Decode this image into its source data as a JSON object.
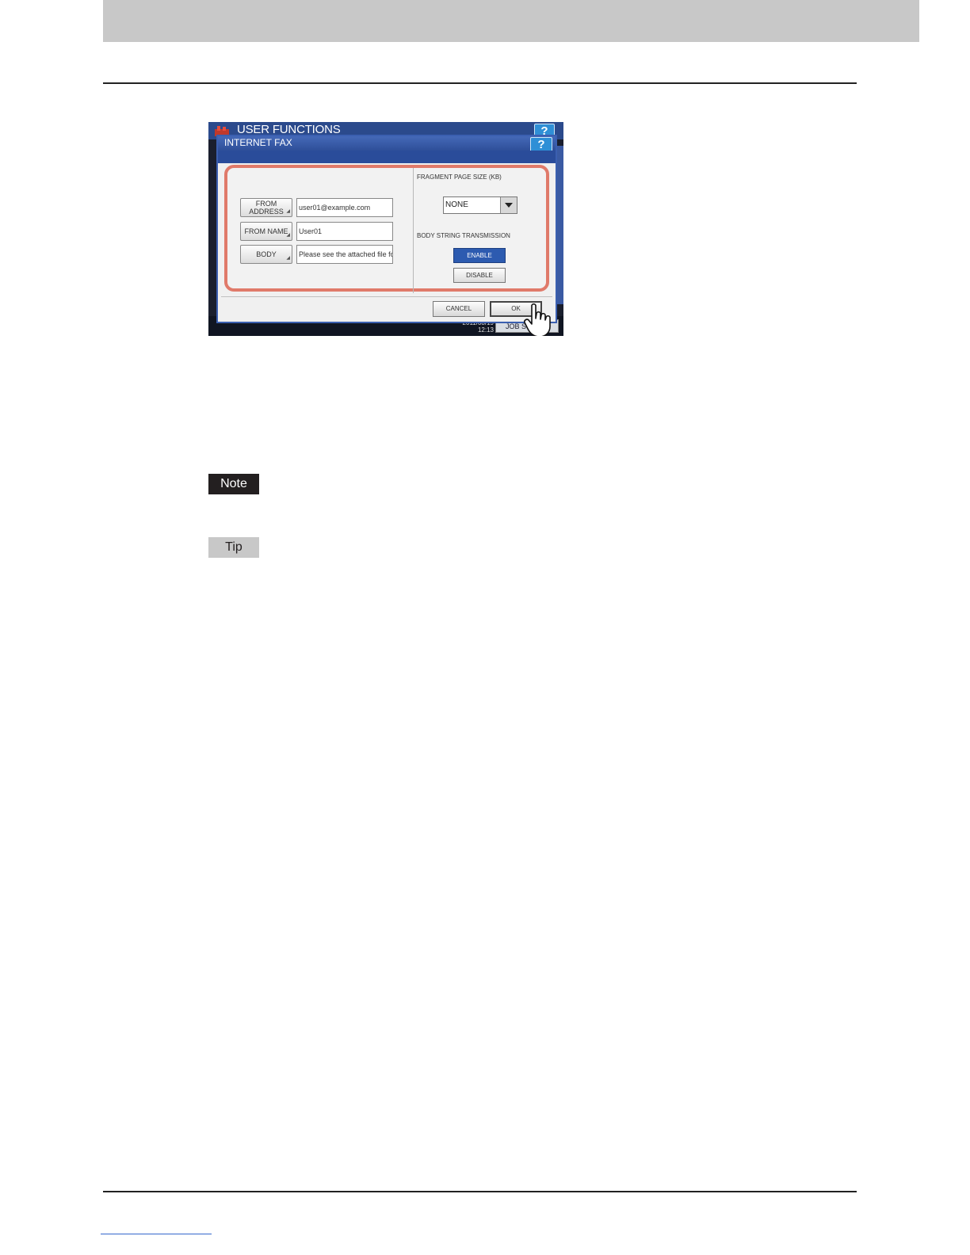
{
  "background_window": {
    "title": "USER FUNCTIONS",
    "help_label": "?",
    "clock": [
      "2011/08/19",
      "12:13"
    ],
    "job_button_label": "JOB S"
  },
  "dialog": {
    "title": "INTERNET FAX",
    "help_label": "?",
    "fields": [
      {
        "button_label_line1": "FROM",
        "button_label_line2": "ADDRESS",
        "value": "user01@example.com"
      },
      {
        "button_label_line1": "FROM NAME",
        "button_label_line2": "",
        "value": "User01"
      },
      {
        "button_label_line1": "BODY",
        "button_label_line2": "",
        "value": "Please see the attached file fo"
      }
    ],
    "fragment_page_size_label": "FRAGMENT PAGE SIZE (KB)",
    "fragment_page_size_value": "NONE",
    "body_string_label": "BODY STRING TRANSMISSION",
    "enable_label": "ENABLE",
    "disable_label": "DISABLE",
    "cancel_label": "CANCEL",
    "ok_label": "OK"
  },
  "labels": {
    "note": "Note",
    "tip": "Tip"
  },
  "colors": {
    "highlight": "#e07a6a",
    "title_bar": "#2b4a8c",
    "enable_active": "#2d5bb0"
  }
}
